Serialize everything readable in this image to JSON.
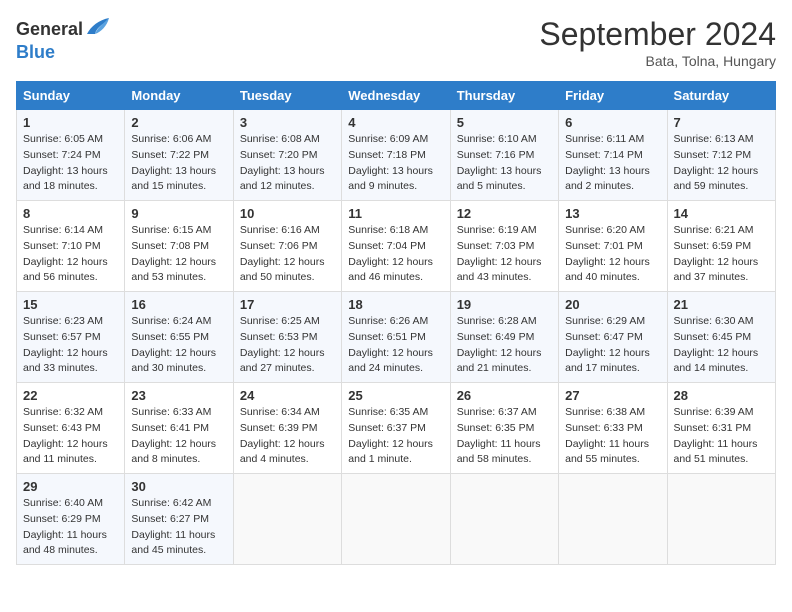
{
  "header": {
    "logo_general": "General",
    "logo_blue": "Blue",
    "title": "September 2024",
    "location": "Bata, Tolna, Hungary"
  },
  "days_of_week": [
    "Sunday",
    "Monday",
    "Tuesday",
    "Wednesday",
    "Thursday",
    "Friday",
    "Saturday"
  ],
  "weeks": [
    [
      {
        "day": "1",
        "sunrise": "6:05 AM",
        "sunset": "7:24 PM",
        "daylight": "13 hours and 18 minutes."
      },
      {
        "day": "2",
        "sunrise": "6:06 AM",
        "sunset": "7:22 PM",
        "daylight": "13 hours and 15 minutes."
      },
      {
        "day": "3",
        "sunrise": "6:08 AM",
        "sunset": "7:20 PM",
        "daylight": "13 hours and 12 minutes."
      },
      {
        "day": "4",
        "sunrise": "6:09 AM",
        "sunset": "7:18 PM",
        "daylight": "13 hours and 9 minutes."
      },
      {
        "day": "5",
        "sunrise": "6:10 AM",
        "sunset": "7:16 PM",
        "daylight": "13 hours and 5 minutes."
      },
      {
        "day": "6",
        "sunrise": "6:11 AM",
        "sunset": "7:14 PM",
        "daylight": "13 hours and 2 minutes."
      },
      {
        "day": "7",
        "sunrise": "6:13 AM",
        "sunset": "7:12 PM",
        "daylight": "12 hours and 59 minutes."
      }
    ],
    [
      {
        "day": "8",
        "sunrise": "6:14 AM",
        "sunset": "7:10 PM",
        "daylight": "12 hours and 56 minutes."
      },
      {
        "day": "9",
        "sunrise": "6:15 AM",
        "sunset": "7:08 PM",
        "daylight": "12 hours and 53 minutes."
      },
      {
        "day": "10",
        "sunrise": "6:16 AM",
        "sunset": "7:06 PM",
        "daylight": "12 hours and 50 minutes."
      },
      {
        "day": "11",
        "sunrise": "6:18 AM",
        "sunset": "7:04 PM",
        "daylight": "12 hours and 46 minutes."
      },
      {
        "day": "12",
        "sunrise": "6:19 AM",
        "sunset": "7:03 PM",
        "daylight": "12 hours and 43 minutes."
      },
      {
        "day": "13",
        "sunrise": "6:20 AM",
        "sunset": "7:01 PM",
        "daylight": "12 hours and 40 minutes."
      },
      {
        "day": "14",
        "sunrise": "6:21 AM",
        "sunset": "6:59 PM",
        "daylight": "12 hours and 37 minutes."
      }
    ],
    [
      {
        "day": "15",
        "sunrise": "6:23 AM",
        "sunset": "6:57 PM",
        "daylight": "12 hours and 33 minutes."
      },
      {
        "day": "16",
        "sunrise": "6:24 AM",
        "sunset": "6:55 PM",
        "daylight": "12 hours and 30 minutes."
      },
      {
        "day": "17",
        "sunrise": "6:25 AM",
        "sunset": "6:53 PM",
        "daylight": "12 hours and 27 minutes."
      },
      {
        "day": "18",
        "sunrise": "6:26 AM",
        "sunset": "6:51 PM",
        "daylight": "12 hours and 24 minutes."
      },
      {
        "day": "19",
        "sunrise": "6:28 AM",
        "sunset": "6:49 PM",
        "daylight": "12 hours and 21 minutes."
      },
      {
        "day": "20",
        "sunrise": "6:29 AM",
        "sunset": "6:47 PM",
        "daylight": "12 hours and 17 minutes."
      },
      {
        "day": "21",
        "sunrise": "6:30 AM",
        "sunset": "6:45 PM",
        "daylight": "12 hours and 14 minutes."
      }
    ],
    [
      {
        "day": "22",
        "sunrise": "6:32 AM",
        "sunset": "6:43 PM",
        "daylight": "12 hours and 11 minutes."
      },
      {
        "day": "23",
        "sunrise": "6:33 AM",
        "sunset": "6:41 PM",
        "daylight": "12 hours and 8 minutes."
      },
      {
        "day": "24",
        "sunrise": "6:34 AM",
        "sunset": "6:39 PM",
        "daylight": "12 hours and 4 minutes."
      },
      {
        "day": "25",
        "sunrise": "6:35 AM",
        "sunset": "6:37 PM",
        "daylight": "12 hours and 1 minute."
      },
      {
        "day": "26",
        "sunrise": "6:37 AM",
        "sunset": "6:35 PM",
        "daylight": "11 hours and 58 minutes."
      },
      {
        "day": "27",
        "sunrise": "6:38 AM",
        "sunset": "6:33 PM",
        "daylight": "11 hours and 55 minutes."
      },
      {
        "day": "28",
        "sunrise": "6:39 AM",
        "sunset": "6:31 PM",
        "daylight": "11 hours and 51 minutes."
      }
    ],
    [
      {
        "day": "29",
        "sunrise": "6:40 AM",
        "sunset": "6:29 PM",
        "daylight": "11 hours and 48 minutes."
      },
      {
        "day": "30",
        "sunrise": "6:42 AM",
        "sunset": "6:27 PM",
        "daylight": "11 hours and 45 minutes."
      },
      null,
      null,
      null,
      null,
      null
    ]
  ]
}
